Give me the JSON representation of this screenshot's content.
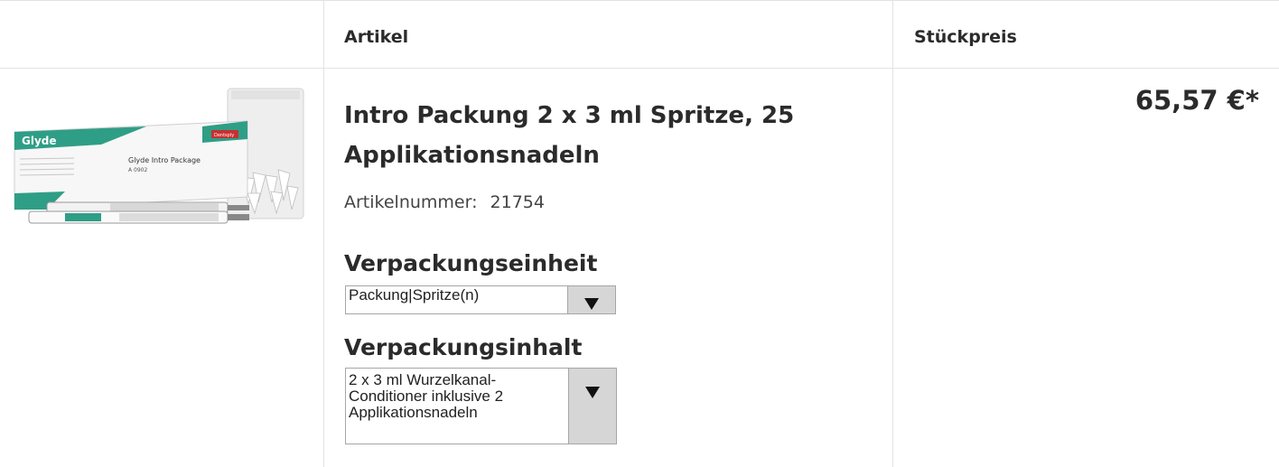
{
  "header": {
    "col_article": "Artikel",
    "col_unit_price": "Stückpreis"
  },
  "product": {
    "title": "Intro Packung 2 x 3 ml Spritze, 25 Applikationsnadeln",
    "article_number_label": "Artikelnummer:",
    "article_number": "21754",
    "price": "65,57 €*",
    "image": {
      "brand": "Glyde",
      "box_label": "Glyde Intro Package",
      "box_code": "A 0902",
      "maker": "Dentsply"
    },
    "packaging_unit": {
      "label": "Verpackungseinheit",
      "selected": "Packung|Spritze(n)"
    },
    "packaging_content": {
      "label": "Verpackungsinhalt",
      "selected_lines": [
        "2 x 3 ml Wurzelkanal-",
        "Conditioner inklusive 2",
        "Applikationsnadeln"
      ]
    }
  },
  "colors": {
    "border": "#e3e3e3",
    "select_button": "#d6d6d6",
    "box_green": "#2f9e86"
  }
}
